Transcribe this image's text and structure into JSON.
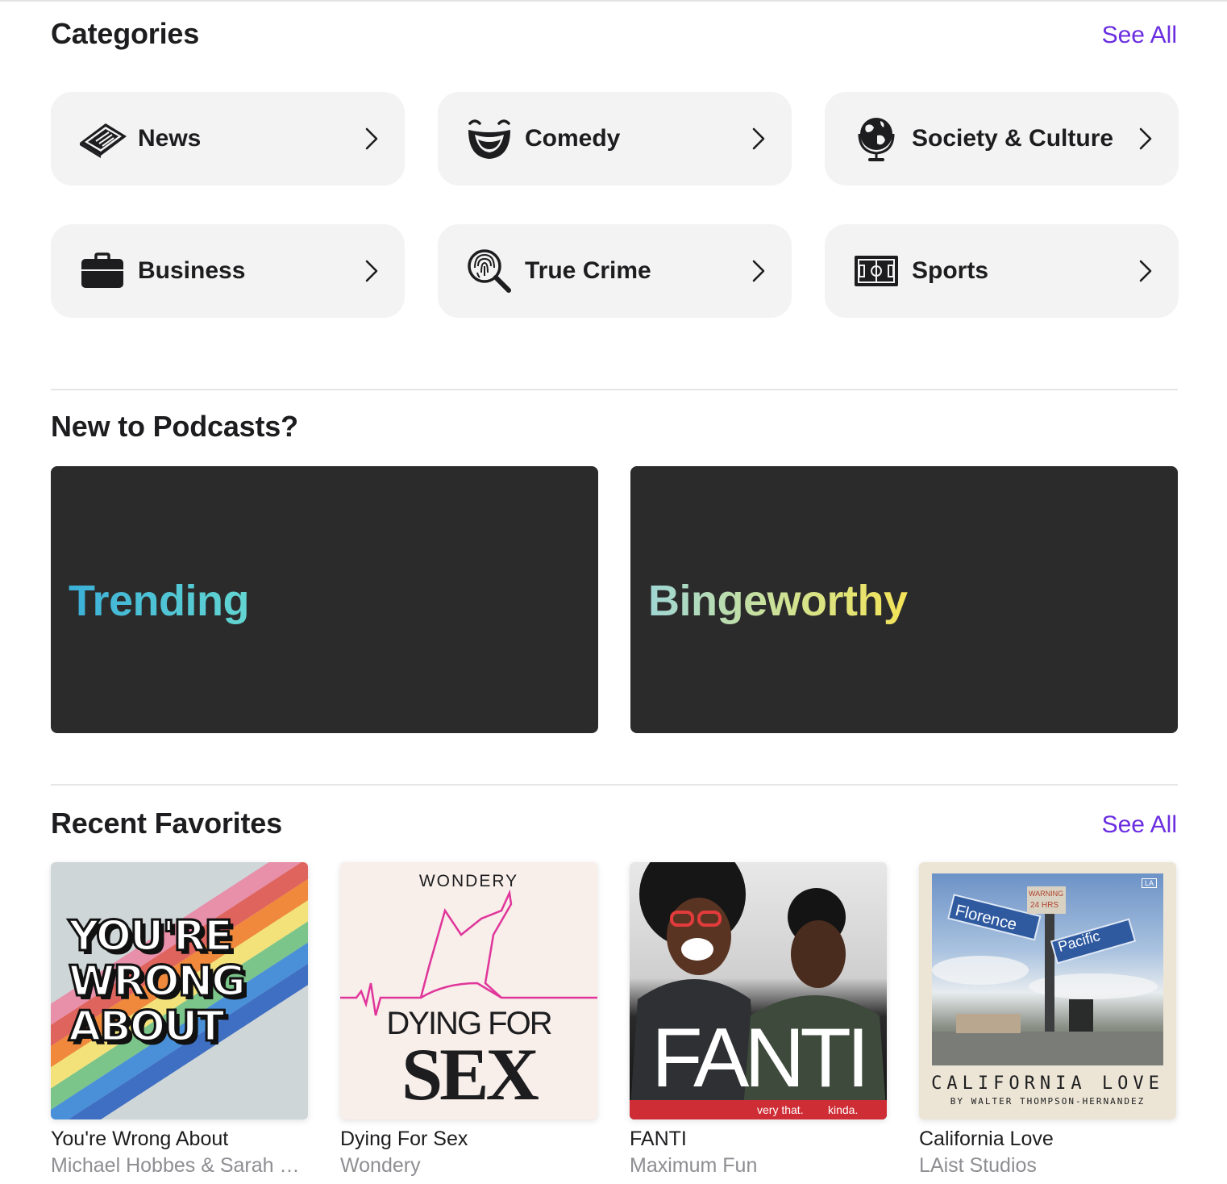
{
  "categories": {
    "title": "Categories",
    "see_all": "See All",
    "items": [
      {
        "label": "News",
        "icon": "newspaper-icon"
      },
      {
        "label": "Comedy",
        "icon": "comedy-mask-icon"
      },
      {
        "label": "Society & Culture",
        "icon": "globe-icon"
      },
      {
        "label": "Business",
        "icon": "briefcase-icon"
      },
      {
        "label": "True Crime",
        "icon": "fingerprint-magnifier-icon"
      },
      {
        "label": "Sports",
        "icon": "sports-field-icon"
      }
    ]
  },
  "new_to_podcasts": {
    "title": "New to Podcasts?",
    "tiles": [
      {
        "label": "Trending"
      },
      {
        "label": "Bingeworthy"
      }
    ]
  },
  "recent_favorites": {
    "title": "Recent Favorites",
    "see_all": "See All",
    "items": [
      {
        "title": "You're Wrong About",
        "author": "Michael Hobbes & Sarah M...",
        "art_lines": [
          "YOU'RE",
          "WRONG",
          "ABOUT"
        ]
      },
      {
        "title": "Dying For Sex",
        "author": "Wondery",
        "art_brand": "WONDERY",
        "art_line1": "DYING FOR",
        "art_line2": "SEX"
      },
      {
        "title": "FANTI",
        "author": "Maximum Fun",
        "art_logo": "FANTI",
        "art_tag": "very that.",
        "art_tag2": "kinda."
      },
      {
        "title": "California Love",
        "author": "LAist Studios",
        "art_sign1": "Florence",
        "art_sign2": "Pacific",
        "art_sign3": "WARNING",
        "art_sign4": "24 HRS",
        "art_line1": "CALIFORNIA LOVE",
        "art_line2": "BY WALTER THOMPSON-HERNANDEZ",
        "art_badge": "LA"
      }
    ]
  },
  "colors": {
    "accent": "#6b2ee0",
    "tile_bg": "#2b2b2b",
    "card_bg": "#f3f3f3"
  }
}
